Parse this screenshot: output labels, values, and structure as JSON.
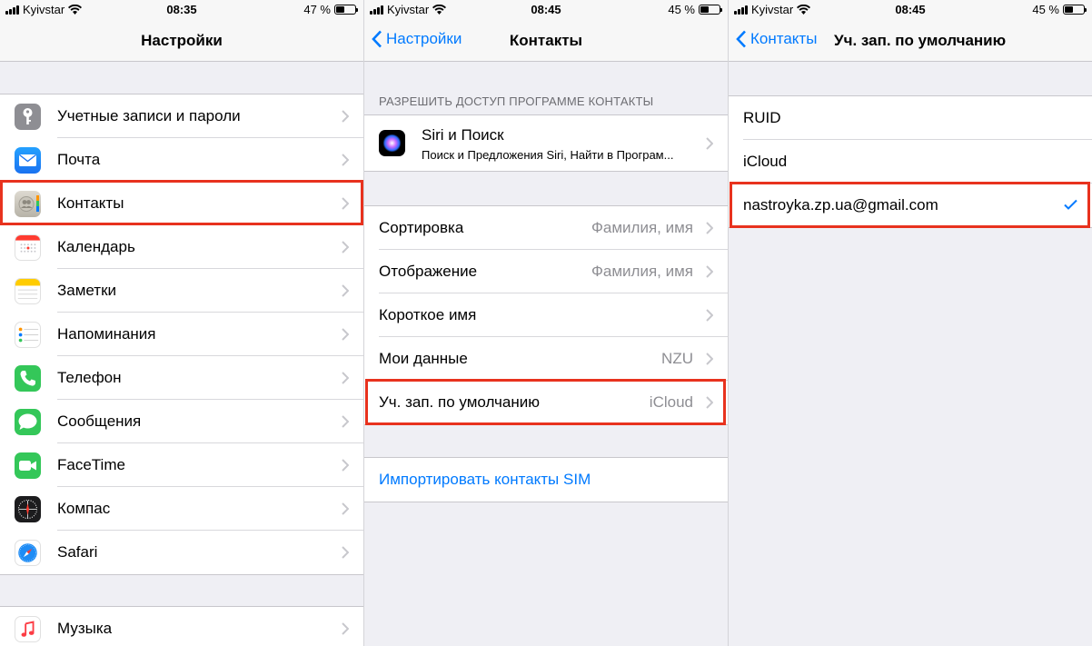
{
  "screen1": {
    "status": {
      "carrier": "Kyivstar",
      "time": "08:35",
      "battery": "47 %",
      "battery_level": 0.47
    },
    "nav": {
      "title": "Настройки"
    },
    "group1": [
      {
        "label": "Учетные записи и пароли",
        "icon": "key-icon",
        "color": "#8e8e93"
      },
      {
        "label": "Почта",
        "icon": "mail-icon",
        "color": "#1e8cf5"
      },
      {
        "label": "Контакты",
        "icon": "contacts-icon",
        "color": "#b7b3a8"
      },
      {
        "label": "Календарь",
        "icon": "calendar-icon",
        "color": "#ffffff"
      },
      {
        "label": "Заметки",
        "icon": "notes-icon",
        "color": "#ffd60a"
      },
      {
        "label": "Напоминания",
        "icon": "reminders-icon",
        "color": "#ffffff"
      },
      {
        "label": "Телефон",
        "icon": "phone-icon",
        "color": "#34c759"
      },
      {
        "label": "Сообщения",
        "icon": "messages-icon",
        "color": "#34c759"
      },
      {
        "label": "FaceTime",
        "icon": "facetime-icon",
        "color": "#34c759"
      },
      {
        "label": "Компас",
        "icon": "compass-icon",
        "color": "#1c1c1e"
      },
      {
        "label": "Safari",
        "icon": "safari-icon",
        "color": "#ffffff"
      }
    ],
    "group2": [
      {
        "label": "Музыка",
        "icon": "music-icon",
        "color": "#ffffff"
      }
    ]
  },
  "screen2": {
    "status": {
      "carrier": "Kyivstar",
      "time": "08:45",
      "battery": "45 %",
      "battery_level": 0.45
    },
    "nav": {
      "back": "Настройки",
      "title": "Контакты"
    },
    "section_header": "РАЗРЕШИТЬ ДОСТУП ПРОГРАММЕ КОНТАКТЫ",
    "siri": {
      "title": "Siri и Поиск",
      "subtitle": "Поиск и Предложения Siri, Найти в Програм..."
    },
    "group": [
      {
        "label": "Сортировка",
        "value": "Фамилия, имя"
      },
      {
        "label": "Отображение",
        "value": "Фамилия, имя"
      },
      {
        "label": "Короткое имя",
        "value": ""
      },
      {
        "label": "Мои данные",
        "value": "NZU"
      },
      {
        "label": "Уч. зап. по умолчанию",
        "value": "iCloud"
      }
    ],
    "import": "Импортировать контакты SIM"
  },
  "screen3": {
    "status": {
      "carrier": "Kyivstar",
      "time": "08:45",
      "battery": "45 %",
      "battery_level": 0.45
    },
    "nav": {
      "back": "Контакты",
      "title": "Уч. зап. по умолчанию"
    },
    "accounts": [
      {
        "label": "RUID",
        "selected": false
      },
      {
        "label": "iCloud",
        "selected": false
      },
      {
        "label": "nastroyka.zp.ua@gmail.com",
        "selected": true
      }
    ]
  },
  "colors": {
    "accent": "#007aff",
    "highlight": "#e8321e",
    "background": "#efeff4"
  }
}
